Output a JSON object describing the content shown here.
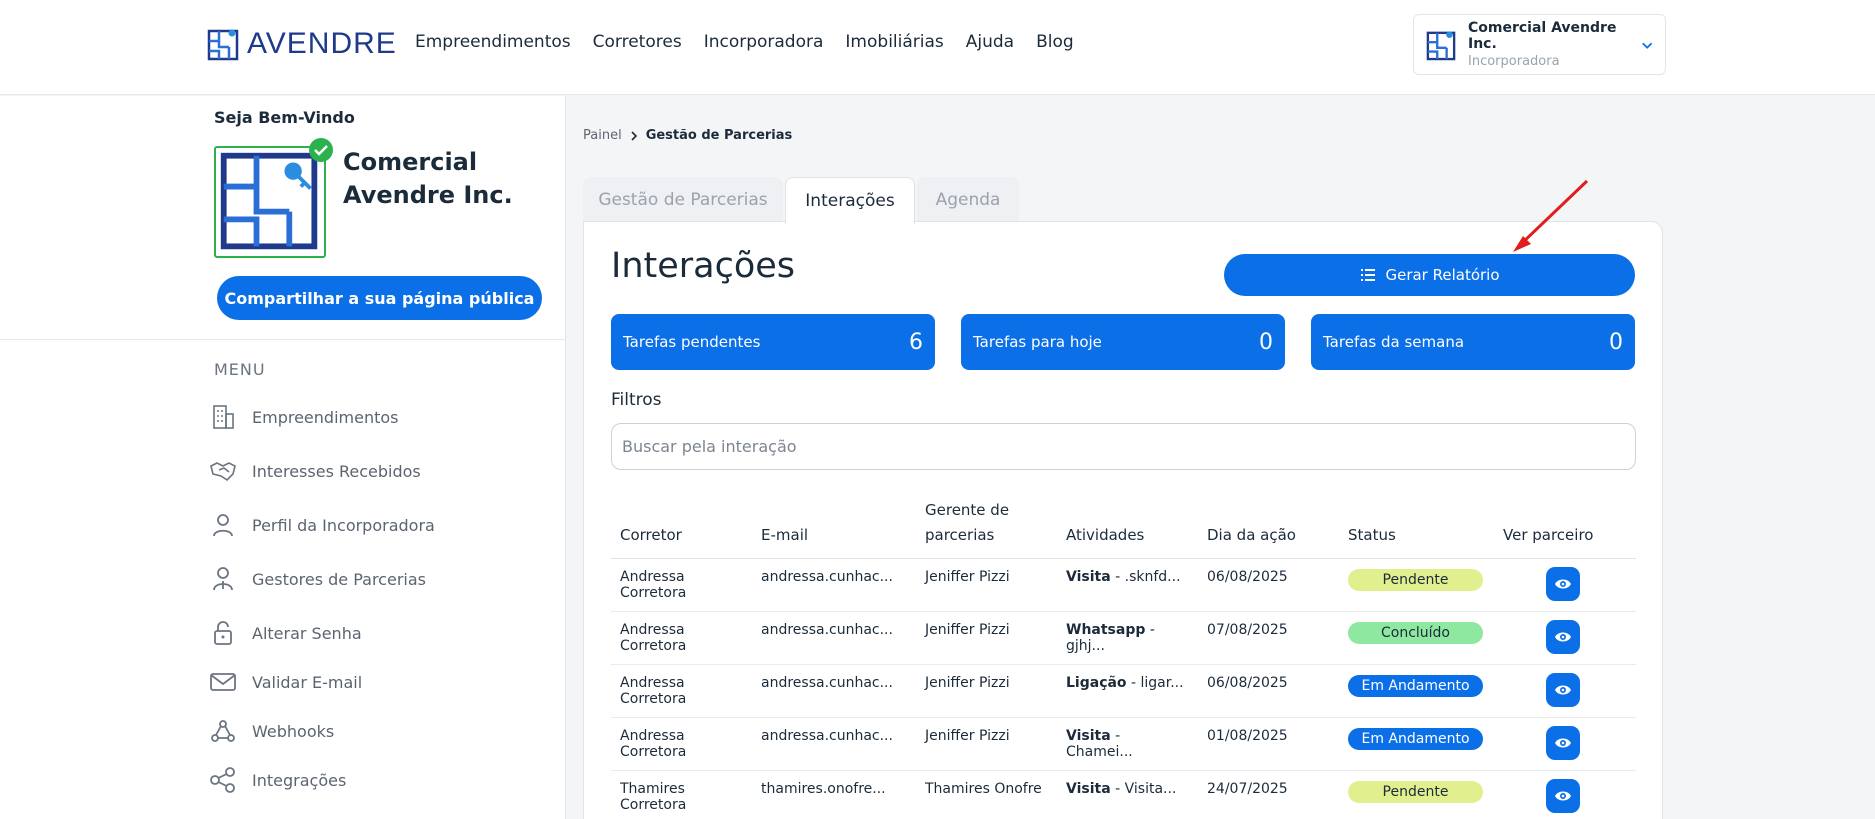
{
  "header": {
    "logo_text": "AVENDRE",
    "nav": [
      "Empreendimentos",
      "Corretores",
      "Incorporadora",
      "Imobiliárias",
      "Ajuda",
      "Blog"
    ],
    "account": {
      "name": "Comercial Avendre Inc.",
      "role": "Incorporadora"
    }
  },
  "sidebar": {
    "welcome": "Seja Bem-Vindo",
    "company_name": "Comercial Avendre Inc.",
    "share_button": "Compartilhar a sua página pública",
    "menu_label": "MENU",
    "items": [
      {
        "label": "Empreendimentos",
        "icon": "building-icon"
      },
      {
        "label": "Interesses Recebidos",
        "icon": "handshake-icon"
      },
      {
        "label": "Perfil da Incorporadora",
        "icon": "user-icon"
      },
      {
        "label": "Gestores de Parcerias",
        "icon": "user-tie-icon"
      },
      {
        "label": "Alterar Senha",
        "icon": "lock-icon"
      },
      {
        "label": "Validar E-mail",
        "icon": "mail-icon"
      },
      {
        "label": "Webhooks",
        "icon": "webhook-icon"
      },
      {
        "label": "Integrações",
        "icon": "share-nodes-icon"
      }
    ]
  },
  "breadcrumb": {
    "root": "Painel",
    "current": "Gestão de Parcerias"
  },
  "tabs": [
    "Gestão de Parcerias",
    "Interações",
    "Agenda"
  ],
  "main": {
    "title": "Interações",
    "report_button": "Gerar Relatório",
    "stats": [
      {
        "label": "Tarefas pendentes",
        "value": "6"
      },
      {
        "label": "Tarefas para hoje",
        "value": "0"
      },
      {
        "label": "Tarefas da semana",
        "value": "0"
      }
    ],
    "filters_title": "Filtros",
    "search_placeholder": "Buscar pela interação"
  },
  "table": {
    "headers": [
      "Corretor",
      "E-mail",
      "Gerente de parcerias",
      "Atividades",
      "Dia da ação",
      "Status",
      "Ver parceiro"
    ],
    "rows": [
      {
        "corretor": "Andressa Corretora",
        "email": "andressa.cunhac...",
        "gerente": "Jeniffer Pizzi",
        "atividade_tipo": "Visita",
        "atividade_desc": " - .sknfd...",
        "dia": "06/08/2025",
        "status": "Pendente",
        "status_class": "pendente"
      },
      {
        "corretor": "Andressa Corretora",
        "email": "andressa.cunhac...",
        "gerente": "Jeniffer Pizzi",
        "atividade_tipo": "Whatsapp",
        "atividade_desc": " - gjhj...",
        "dia": "07/08/2025",
        "status": "Concluído",
        "status_class": "concluido"
      },
      {
        "corretor": "Andressa Corretora",
        "email": "andressa.cunhac...",
        "gerente": "Jeniffer Pizzi",
        "atividade_tipo": "Ligação",
        "atividade_desc": " - ligar...",
        "dia": "06/08/2025",
        "status": "Em Andamento",
        "status_class": "andamento"
      },
      {
        "corretor": "Andressa Corretora",
        "email": "andressa.cunhac...",
        "gerente": "Jeniffer Pizzi",
        "atividade_tipo": "Visita",
        "atividade_desc": " - Chamei...",
        "dia": "01/08/2025",
        "status": "Em Andamento",
        "status_class": "andamento"
      },
      {
        "corretor": "Thamires Corretora",
        "email": "thamires.onofre...",
        "gerente": "Thamires Onofre",
        "atividade_tipo": "Visita",
        "atividade_desc": " - Visita...",
        "dia": "24/07/2025",
        "status": "Pendente",
        "status_class": "pendente"
      }
    ]
  },
  "colors": {
    "primary": "#0b6fe8",
    "pending": "#e2ef8f",
    "done": "#8ee8a0",
    "verified": "#2bb24c"
  }
}
